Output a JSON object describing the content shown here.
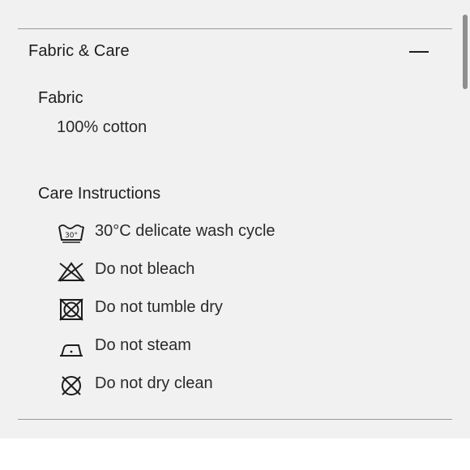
{
  "accordion": {
    "title": "Fabric & Care",
    "toggle_icon": "minus-icon",
    "expanded": true
  },
  "fabric": {
    "heading": "Fabric",
    "value": "100% cotton"
  },
  "care": {
    "heading": "Care Instructions",
    "items": [
      {
        "icon": "wash-30-delicate-icon",
        "icon_text": "30°",
        "label": "30°C delicate wash cycle"
      },
      {
        "icon": "no-bleach-icon",
        "label": "Do not bleach"
      },
      {
        "icon": "no-tumble-dry-icon",
        "label": "Do not tumble dry"
      },
      {
        "icon": "no-steam-iron-icon",
        "label": "Do not steam"
      },
      {
        "icon": "no-dry-clean-icon",
        "label": "Do not dry clean"
      }
    ]
  },
  "colors": {
    "panel_background": "#f1f1f1",
    "divider": "#9a9a9a",
    "text": "#1d1d1d",
    "scrollbar_thumb": "#8e8e8e"
  }
}
